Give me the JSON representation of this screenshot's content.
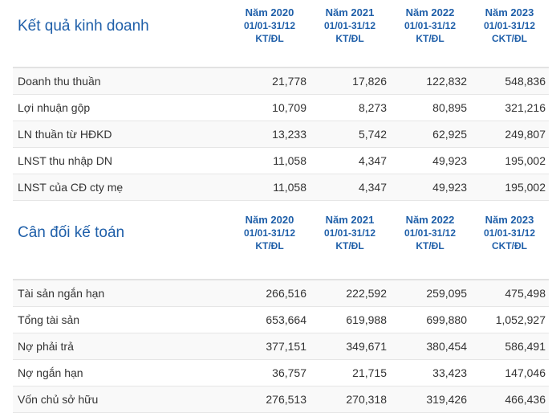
{
  "sections": [
    {
      "title": "Kết quả kinh doanh",
      "columns": [
        {
          "year": "Năm 2020",
          "range": "01/01-31/12",
          "audit": "KT/ĐL"
        },
        {
          "year": "Năm 2021",
          "range": "01/01-31/12",
          "audit": "KT/ĐL"
        },
        {
          "year": "Năm 2022",
          "range": "01/01-31/12",
          "audit": "KT/ĐL"
        },
        {
          "year": "Năm 2023",
          "range": "01/01-31/12",
          "audit": "CKT/ĐL"
        }
      ],
      "rows": [
        {
          "label": "Doanh thu thuần",
          "values": [
            "21,778",
            "17,826",
            "122,832",
            "548,836"
          ]
        },
        {
          "label": "Lợi nhuận gộp",
          "values": [
            "10,709",
            "8,273",
            "80,895",
            "321,216"
          ]
        },
        {
          "label": "LN thuần từ HĐKD",
          "values": [
            "13,233",
            "5,742",
            "62,925",
            "249,807"
          ]
        },
        {
          "label": "LNST thu nhập DN",
          "values": [
            "11,058",
            "4,347",
            "49,923",
            "195,002"
          ]
        },
        {
          "label": "LNST của CĐ cty mẹ",
          "values": [
            "11,058",
            "4,347",
            "49,923",
            "195,002"
          ]
        }
      ]
    },
    {
      "title": "Cân đối kế toán",
      "columns": [
        {
          "year": "Năm 2020",
          "range": "01/01-31/12",
          "audit": "KT/ĐL"
        },
        {
          "year": "Năm 2021",
          "range": "01/01-31/12",
          "audit": "KT/ĐL"
        },
        {
          "year": "Năm 2022",
          "range": "01/01-31/12",
          "audit": "KT/ĐL"
        },
        {
          "year": "Năm 2023",
          "range": "01/01-31/12",
          "audit": "CKT/ĐL"
        }
      ],
      "rows": [
        {
          "label": "Tài sản ngắn hạn",
          "values": [
            "266,516",
            "222,592",
            "259,095",
            "475,498"
          ]
        },
        {
          "label": "Tổng tài sản",
          "values": [
            "653,664",
            "619,988",
            "699,880",
            "1,052,927"
          ]
        },
        {
          "label": "Nợ phải trả",
          "values": [
            "377,151",
            "349,671",
            "380,454",
            "586,491"
          ]
        },
        {
          "label": "Nợ ngắn hạn",
          "values": [
            "36,757",
            "21,715",
            "33,423",
            "147,046"
          ]
        },
        {
          "label": "Vốn chủ sở hữu",
          "values": [
            "276,513",
            "270,318",
            "319,426",
            "466,436"
          ]
        }
      ]
    }
  ],
  "colors": {
    "accent": "#1f5fa9",
    "row_alt": "#f9f9f9",
    "border": "#e6e6e6"
  }
}
